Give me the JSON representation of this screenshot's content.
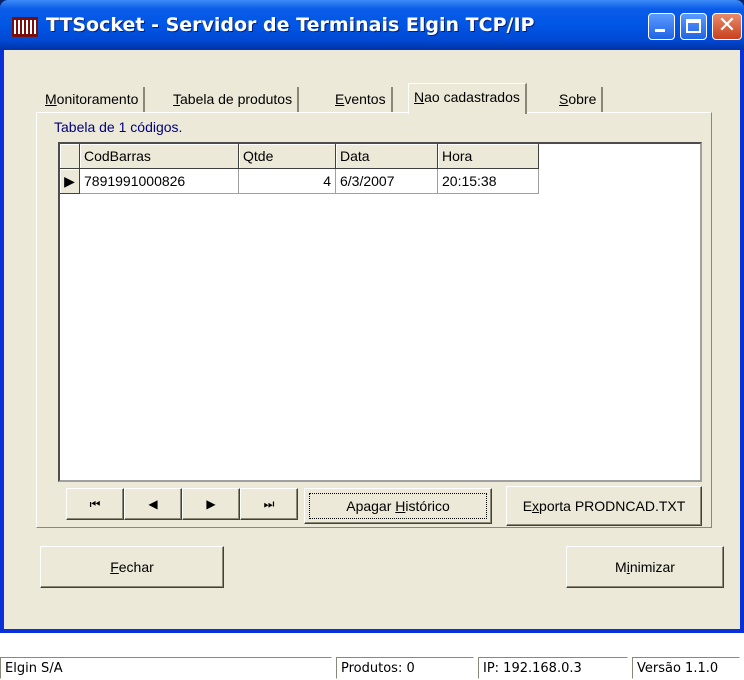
{
  "window": {
    "title": "TTSocket  - Servidor de Terminais Elgin TCP/IP"
  },
  "tabs": [
    {
      "pre": "",
      "u": "M",
      "post": "onitoramento"
    },
    {
      "pre": "",
      "u": "T",
      "post": "abela de produtos"
    },
    {
      "pre": "",
      "u": "E",
      "post": "ventos"
    },
    {
      "pre": "",
      "u": "N",
      "post": "ao cadastrados"
    },
    {
      "pre": "",
      "u": "S",
      "post": "obre"
    }
  ],
  "active_tab": "Nao cadastrados",
  "table_count": "Tabela de 1 códigos.",
  "grid": {
    "columns": [
      "CodBarras",
      "Qtde",
      "Data",
      "Hora"
    ],
    "rows": [
      {
        "CodBarras": "7891991000826",
        "Qtde": "4",
        "Data": "6/3/2007",
        "Hora": "20:15:38"
      }
    ]
  },
  "navigator": {
    "first": "⏮",
    "prior": "◀",
    "next": "▶",
    "last": "⏭"
  },
  "buttons": {
    "apagar": {
      "pre": "Apagar ",
      "u": "H",
      "post": "istórico"
    },
    "exporta": {
      "pre": "E",
      "u": "x",
      "post": "porta PRODNCAD.TXT"
    },
    "fechar": {
      "pre": "",
      "u": "F",
      "post": "echar"
    },
    "minimizar": {
      "pre": "M",
      "u": "i",
      "post": "nimizar"
    }
  },
  "status": {
    "company": "Elgin S/A",
    "produtos": "Produtos: 0",
    "ip": "IP: 192.168.0.3",
    "versao": "Versão 1.1.0"
  },
  "colors": {
    "titlebar": "#0056e5",
    "face": "#ece9d8",
    "count_text": "#000080"
  }
}
